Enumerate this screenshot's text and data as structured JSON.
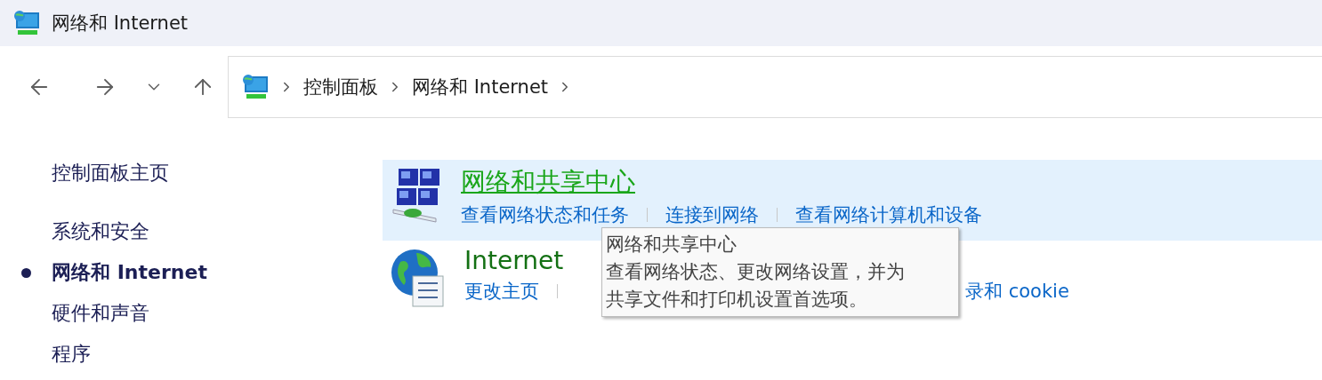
{
  "window": {
    "title": "网络和 Internet"
  },
  "breadcrumb": [
    {
      "label": "控制面板"
    },
    {
      "label": "网络和 Internet"
    }
  ],
  "sidebar": {
    "items": [
      {
        "label": "控制面板主页",
        "kind": "home",
        "selected": false
      },
      {
        "label": "系统和安全",
        "kind": "category",
        "selected": false
      },
      {
        "label": "网络和 Internet",
        "kind": "category",
        "selected": true
      },
      {
        "label": "硬件和声音",
        "kind": "category",
        "selected": false
      },
      {
        "label": "程序",
        "kind": "category",
        "selected": false
      }
    ]
  },
  "categories": [
    {
      "title": "网络和共享中心",
      "kind": "network",
      "hovered": true,
      "links": [
        {
          "label": "查看网络状态和任务",
          "covered_before": false
        },
        {
          "label": "连接到网络",
          "covered_before": false
        },
        {
          "label": "查看网络计算机和设备",
          "covered_before": false
        }
      ]
    },
    {
      "title": "Internet",
      "kind": "globe",
      "hovered": false,
      "links": [
        {
          "label": "更改主页",
          "covered_before": false
        },
        {
          "label": "录和 cookie",
          "covered_before": true
        }
      ]
    }
  ],
  "tooltip": {
    "title": "网络和共享中心",
    "lines": [
      "查看网络状态、更改网络设置，并为",
      "共享文件和打印机设置首选项。"
    ]
  }
}
